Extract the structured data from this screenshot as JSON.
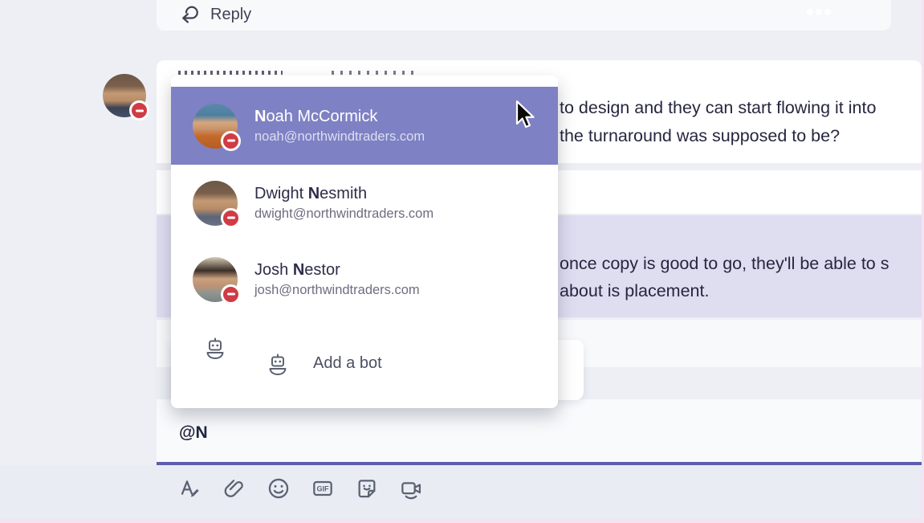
{
  "reply_bar": {
    "label": "Reply",
    "more_options_icon": "ellipsis"
  },
  "thread": {
    "message1": {
      "line1": "to design and they can start flowing it into",
      "line2": "the turnaround was supposed to be?"
    },
    "message_highlighted": {
      "line1": "once copy is good to go, they'll be able to s",
      "line2": "about is placement."
    }
  },
  "mention_popup": {
    "suggestions": [
      {
        "name_prefix": "",
        "name_match": "N",
        "name_suffix": "oah McCormick",
        "email": "noah@northwindtraders.com",
        "selected": true,
        "presence": "do-not-disturb"
      },
      {
        "name_prefix": "Dwight ",
        "name_match": "N",
        "name_suffix": "esmith",
        "email": "dwight@northwindtraders.com",
        "selected": false,
        "presence": "do-not-disturb"
      },
      {
        "name_prefix": "Josh ",
        "name_match": "N",
        "name_suffix": "estor",
        "email": "josh@northwindtraders.com",
        "selected": false,
        "presence": "do-not-disturb"
      }
    ],
    "bot_item": {
      "label": "Add a bot"
    }
  },
  "compose": {
    "value": "@N"
  },
  "toolbar": {
    "icons": [
      "format",
      "attach",
      "emoji",
      "gif",
      "sticker",
      "meet-now"
    ],
    "gif_label": "GIF"
  },
  "colors": {
    "selected_row": "#7e81c3",
    "accent_underline": "#5c5dad",
    "mention_message_bg": "#dfddf0",
    "dnd_badge": "#d03b45"
  }
}
